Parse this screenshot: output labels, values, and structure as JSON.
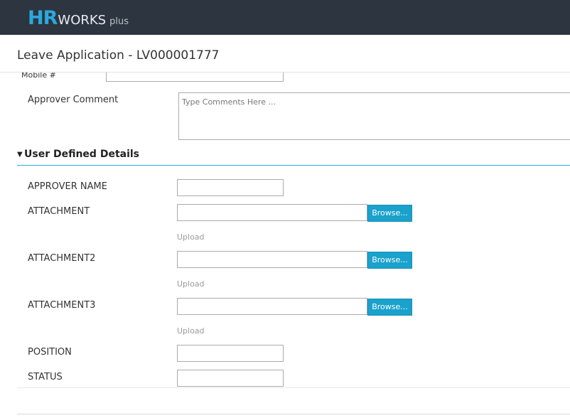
{
  "brand": {
    "hr": "HR",
    "works": "WORKS",
    "plus": "plus",
    "colors": {
      "topbar": "#2d3540",
      "hr": "#2aa8dc",
      "accent": "#1aa1cc"
    }
  },
  "page": {
    "title": "Leave Application - LV000001777"
  },
  "form": {
    "mobile_label": "Mobile #",
    "approver_comment_label": "Approver Comment",
    "approver_comment_placeholder": "Type Comments Here ...",
    "approver_comment_value": ""
  },
  "section": {
    "title": "User Defined Details",
    "caret_icon": "caret-down-icon",
    "fields": {
      "approver_name": {
        "label": "APPROVER NAME",
        "value": ""
      },
      "attachment": {
        "label": "ATTACHMENT",
        "value": "",
        "browse": "Browse...",
        "hint": "Upload"
      },
      "attachment2": {
        "label": "ATTACHMENT2",
        "value": "",
        "browse": "Browse...",
        "hint": "Upload"
      },
      "attachment3": {
        "label": "ATTACHMENT3",
        "value": "",
        "browse": "Browse...",
        "hint": "Upload"
      },
      "position": {
        "label": "POSITION",
        "value": ""
      },
      "status": {
        "label": "STATUS",
        "value": ""
      }
    }
  }
}
